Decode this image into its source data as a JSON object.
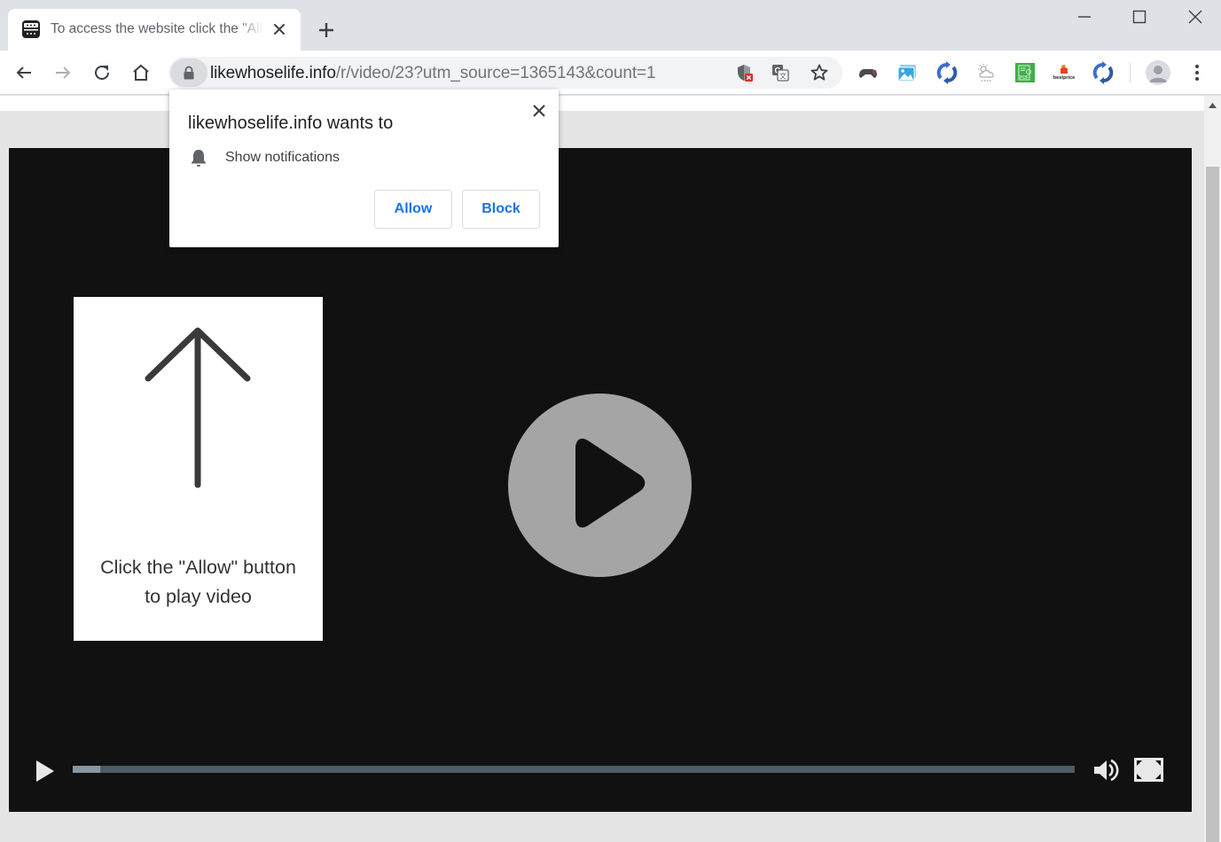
{
  "browser": {
    "tab": {
      "title": "To access the website click the \"Allow\" button",
      "favicon": "video-player-favicon-icon",
      "close_icon": "close-icon"
    },
    "new_tab_icon": "plus-icon",
    "window_controls": [
      "minimize-icon",
      "maximize-icon",
      "close-icon"
    ],
    "nav": {
      "back_icon": "arrow-left-icon",
      "forward_icon": "arrow-right-icon",
      "reload_icon": "reload-icon",
      "home_icon": "home-icon"
    },
    "omnibox": {
      "lock_icon": "lock-icon",
      "url_domain": "likewhoselife.info",
      "url_path": "/r/video/23?utm_source=1365143&count=1",
      "icons": [
        "blocked-notifications-shield-icon",
        "translate-icon",
        "bookmark-star-icon"
      ]
    },
    "extensions": [
      {
        "name": "gamepad-extension-icon"
      },
      {
        "name": "photos-extension-icon"
      },
      {
        "name": "sync-extension-icon"
      },
      {
        "name": "weather-extension-icon"
      },
      {
        "name": "pdf-extension-icon",
        "label": "PDF"
      },
      {
        "name": "bestprice-extension-icon",
        "label": "bestprice"
      },
      {
        "name": "sync-extension-icon-2"
      }
    ],
    "profile_icon": "profile-avatar-icon",
    "menu_icon": "more-vert-icon"
  },
  "permission_prompt": {
    "title": "likewhoselife.info wants to",
    "permission": "Show notifications",
    "permission_icon": "bell-icon",
    "allow_label": "Allow",
    "block_label": "Block",
    "close_icon": "close-icon"
  },
  "page": {
    "hint_text_line1": "Click the \"Allow\" button",
    "hint_text_line2": "to play video",
    "hint_icon": "arrow-up-icon",
    "player": {
      "big_play_icon": "play-circle-icon",
      "play_icon": "play-icon",
      "progress_fraction": 0.027,
      "volume_icon": "volume-icon",
      "fullscreen_icon": "fullscreen-icon"
    }
  },
  "colors": {
    "accent": "#1a73e8",
    "player_bg": "#111111",
    "page_bg": "#e5e5e5",
    "progress_track": "#4f5b62",
    "progress_fill": "#8797a1",
    "big_play": "#a5a5a5"
  }
}
